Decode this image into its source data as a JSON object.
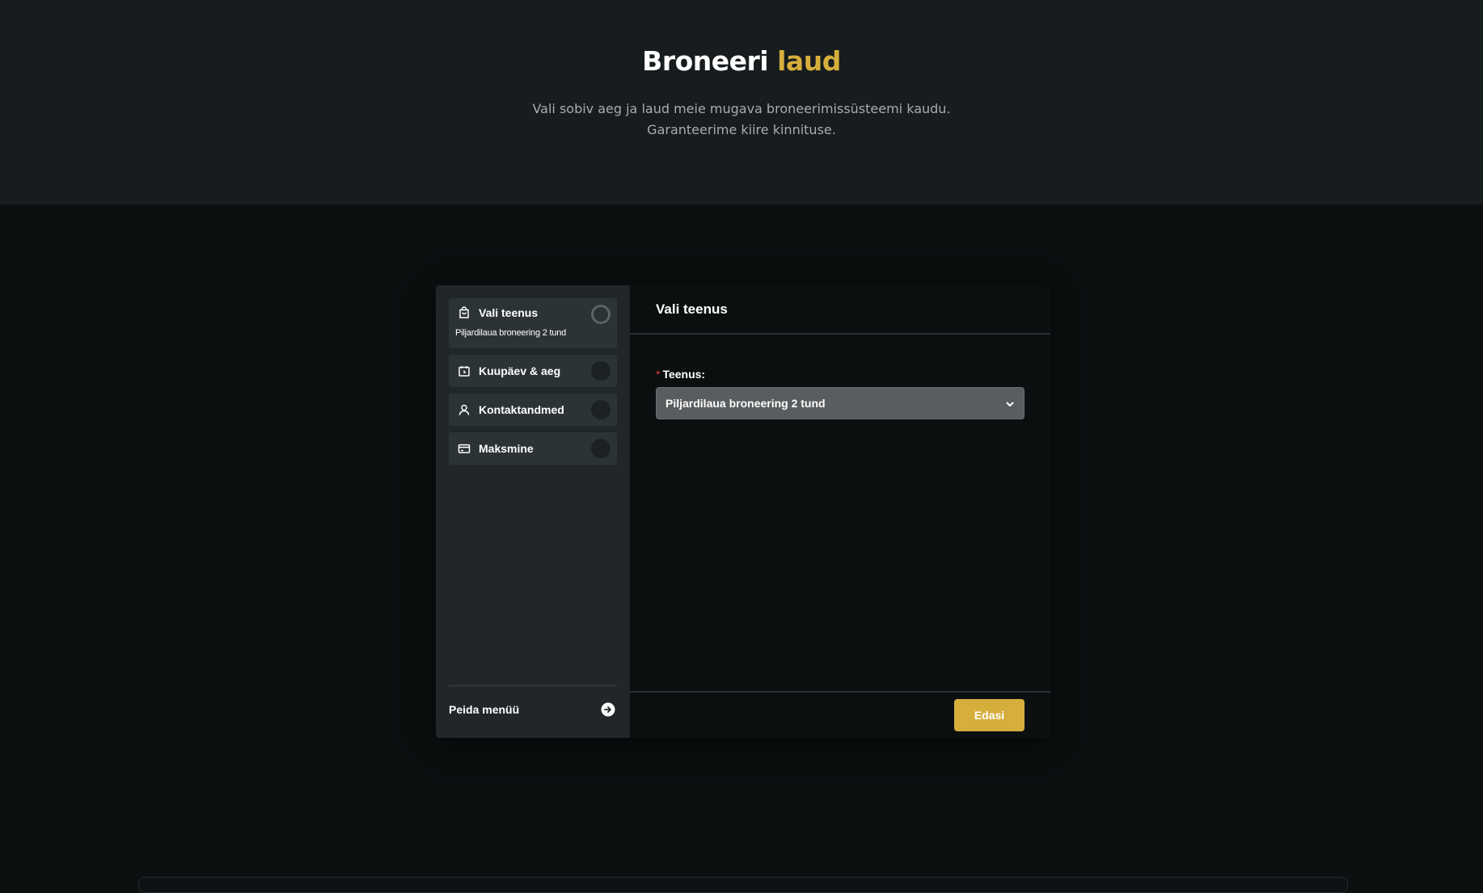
{
  "hero": {
    "title_main": "Broneeri",
    "title_accent": "laud",
    "subtitle_line1": "Vali sobiv aeg ja laud meie mugava broneerimissüsteemi kaudu.",
    "subtitle_line2": "Garanteerime kiire kinnituse."
  },
  "sidebar": {
    "steps": [
      {
        "label": "Vali teenus",
        "description": "Piljardilaua broneering 2 tund",
        "icon": "shopping-bag-icon",
        "state": "active"
      },
      {
        "label": "Kuupäev & aeg",
        "icon": "calendar-clock-icon",
        "state": "pending"
      },
      {
        "label": "Kontaktandmed",
        "icon": "user-icon",
        "state": "pending"
      },
      {
        "label": "Maksmine",
        "icon": "credit-card-icon",
        "state": "pending"
      }
    ],
    "hide_menu_label": "Peida menüü",
    "hide_menu_icon": "arrow-right-circle-icon"
  },
  "main": {
    "title": "Vali teenus",
    "service_field": {
      "required_marker": "*",
      "label": "Teenus:",
      "value": "Piljardilaua broneering 2 tund"
    },
    "next_button_label": "Edasi"
  },
  "colors": {
    "accent": "#d6ae3c",
    "hero_bg": "#171c1f",
    "page_bg": "#0b0f10",
    "sidebar_bg": "#212729",
    "step_bg": "#2c3336",
    "required": "#e0393e"
  }
}
